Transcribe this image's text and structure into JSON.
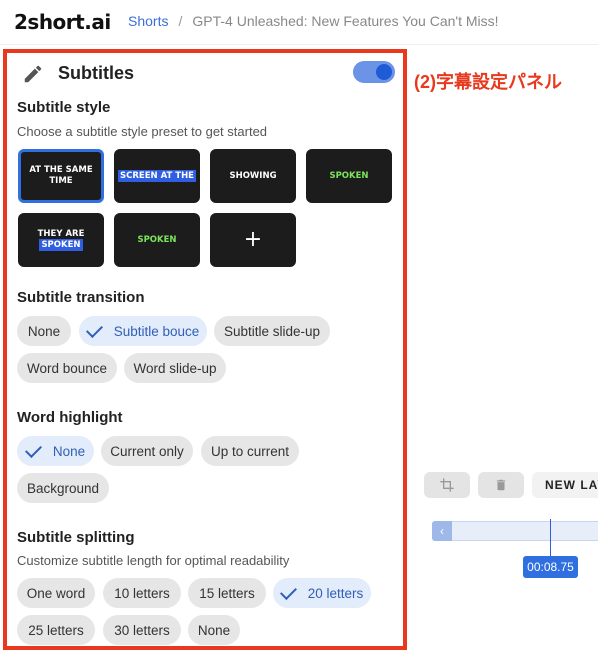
{
  "header": {
    "logo": "2short.ai",
    "breadcrumb": {
      "root": "Shorts",
      "separator": "/",
      "current": "GPT-4 Unleashed: New Features You Can't Miss!"
    }
  },
  "panel": {
    "title": "Subtitles",
    "toggle_on": true,
    "subtitle_style": {
      "title": "Subtitle style",
      "description": "Choose a subtitle style preset to get started",
      "presets": [
        {
          "line1": "AT THE SAME",
          "line2": "TIME",
          "selected": true
        },
        {
          "text": "SCREEN AT THE"
        },
        {
          "text": "SHOWING"
        },
        {
          "text": "SPOKEN"
        },
        {
          "line1": "THEY ARE",
          "line2": "SPOKEN"
        },
        {
          "text": "SPOKEN"
        },
        {
          "text": "+"
        }
      ]
    },
    "transition": {
      "title": "Subtitle transition",
      "options": [
        "None",
        "Subtitle bouce",
        "Subtitle slide-up",
        "Word bounce",
        "Word slide-up"
      ],
      "selected": "Subtitle bouce"
    },
    "highlight": {
      "title": "Word highlight",
      "options": [
        "None",
        "Current only",
        "Up to current",
        "Background"
      ],
      "selected": "None"
    },
    "splitting": {
      "title": "Subtitle splitting",
      "description": "Customize subtitle length for optimal readability",
      "options": [
        "One word",
        "10 letters",
        "15 letters",
        "20 letters",
        "25 letters",
        "30 letters",
        "None"
      ],
      "selected": "20 letters"
    }
  },
  "annotation": "(2)字幕設定パネル",
  "editor": {
    "new_layout_label": "NEW LAY",
    "timeline_arrow": "‹",
    "time": "00:08.75"
  },
  "colors": {
    "accent": "#2f6fe0",
    "annotation_red": "#e8391e",
    "chip_bg": "#e6e6e6",
    "chip_selected_bg": "#e3ecfa"
  }
}
